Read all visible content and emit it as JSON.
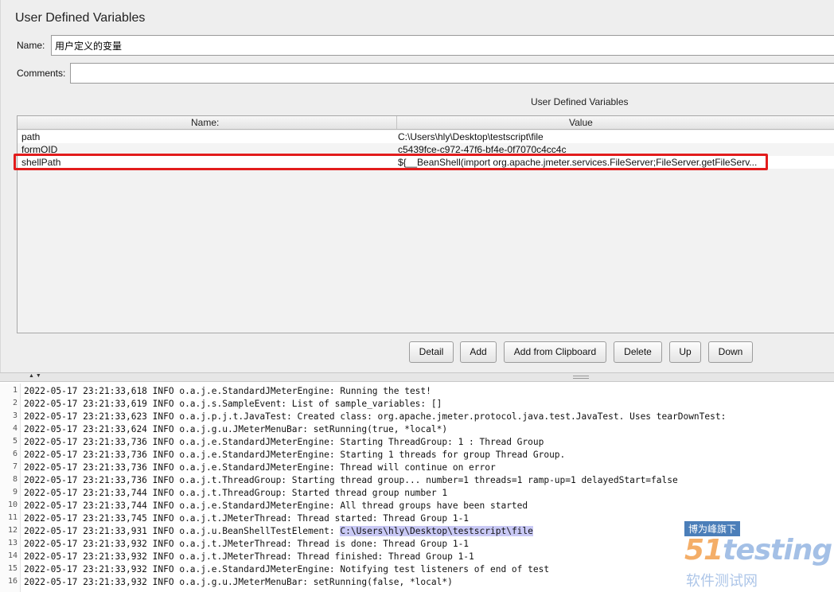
{
  "panel": {
    "title": "User Defined Variables",
    "name_label": "Name:",
    "name_value": "用户定义的变量",
    "comments_label": "Comments:",
    "comments_value": ""
  },
  "table": {
    "caption": "User Defined Variables",
    "col_name": "Name:",
    "col_value": "Value",
    "rows": [
      {
        "name": "path",
        "value": "C:\\Users\\hly\\Desktop\\testscript\\file"
      },
      {
        "name": "formOID",
        "value": "c5439fce-c972-47f6-bf4e-0f7070c4cc4c"
      },
      {
        "name": "shellPath",
        "value": "${__BeanShell(import org.apache.jmeter.services.FileServer;FileServer.getFileServ..."
      }
    ]
  },
  "buttons": {
    "detail": "Detail",
    "add": "Add",
    "add_clipboard": "Add from Clipboard",
    "delete": "Delete",
    "up": "Up",
    "down": "Down"
  },
  "splitter": {
    "arrows": "▲▼"
  },
  "log": {
    "lines": [
      {
        "n": "1",
        "text": "2022-05-17 23:21:33,618 INFO o.a.j.e.StandardJMeterEngine: Running the test!"
      },
      {
        "n": "2",
        "text": "2022-05-17 23:21:33,619 INFO o.a.j.s.SampleEvent: List of sample_variables: []"
      },
      {
        "n": "3",
        "text": "2022-05-17 23:21:33,623 INFO o.a.j.p.j.t.JavaTest: Created class: org.apache.jmeter.protocol.java.test.JavaTest. Uses tearDownTest:"
      },
      {
        "n": "4",
        "text": "2022-05-17 23:21:33,624 INFO o.a.j.g.u.JMeterMenuBar: setRunning(true, *local*)"
      },
      {
        "n": "5",
        "text": "2022-05-17 23:21:33,736 INFO o.a.j.e.StandardJMeterEngine: Starting ThreadGroup: 1 : Thread Group"
      },
      {
        "n": "6",
        "text": "2022-05-17 23:21:33,736 INFO o.a.j.e.StandardJMeterEngine: Starting 1 threads for group Thread Group."
      },
      {
        "n": "7",
        "text": "2022-05-17 23:21:33,736 INFO o.a.j.e.StandardJMeterEngine: Thread will continue on error"
      },
      {
        "n": "8",
        "text": "2022-05-17 23:21:33,736 INFO o.a.j.t.ThreadGroup: Starting thread group... number=1 threads=1 ramp-up=1 delayedStart=false"
      },
      {
        "n": "9",
        "text": "2022-05-17 23:21:33,744 INFO o.a.j.t.ThreadGroup: Started thread group number 1"
      },
      {
        "n": "10",
        "text": "2022-05-17 23:21:33,744 INFO o.a.j.e.StandardJMeterEngine: All thread groups have been started"
      },
      {
        "n": "11",
        "text": "2022-05-17 23:21:33,745 INFO o.a.j.t.JMeterThread: Thread started: Thread Group 1-1"
      },
      {
        "n": "12",
        "text": "2022-05-17 23:21:33,931 INFO o.a.j.u.BeanShellTestElement: ",
        "selected": "C:\\Users\\hly\\Desktop\\testscript\\file"
      },
      {
        "n": "13",
        "text": "2022-05-17 23:21:33,932 INFO o.a.j.t.JMeterThread: Thread is done: Thread Group 1-1"
      },
      {
        "n": "14",
        "text": "2022-05-17 23:21:33,932 INFO o.a.j.t.JMeterThread: Thread finished: Thread Group 1-1"
      },
      {
        "n": "15",
        "text": "2022-05-17 23:21:33,932 INFO o.a.j.e.StandardJMeterEngine: Notifying test listeners of end of test"
      },
      {
        "n": "16",
        "text": "2022-05-17 23:21:33,932 INFO o.a.j.g.u.JMeterMenuBar: setRunning(false, *local*)"
      }
    ]
  },
  "watermark": {
    "tag": "博为峰旗下",
    "logo_num": "51",
    "logo_text": "testing",
    "sub": "软件测试网"
  }
}
